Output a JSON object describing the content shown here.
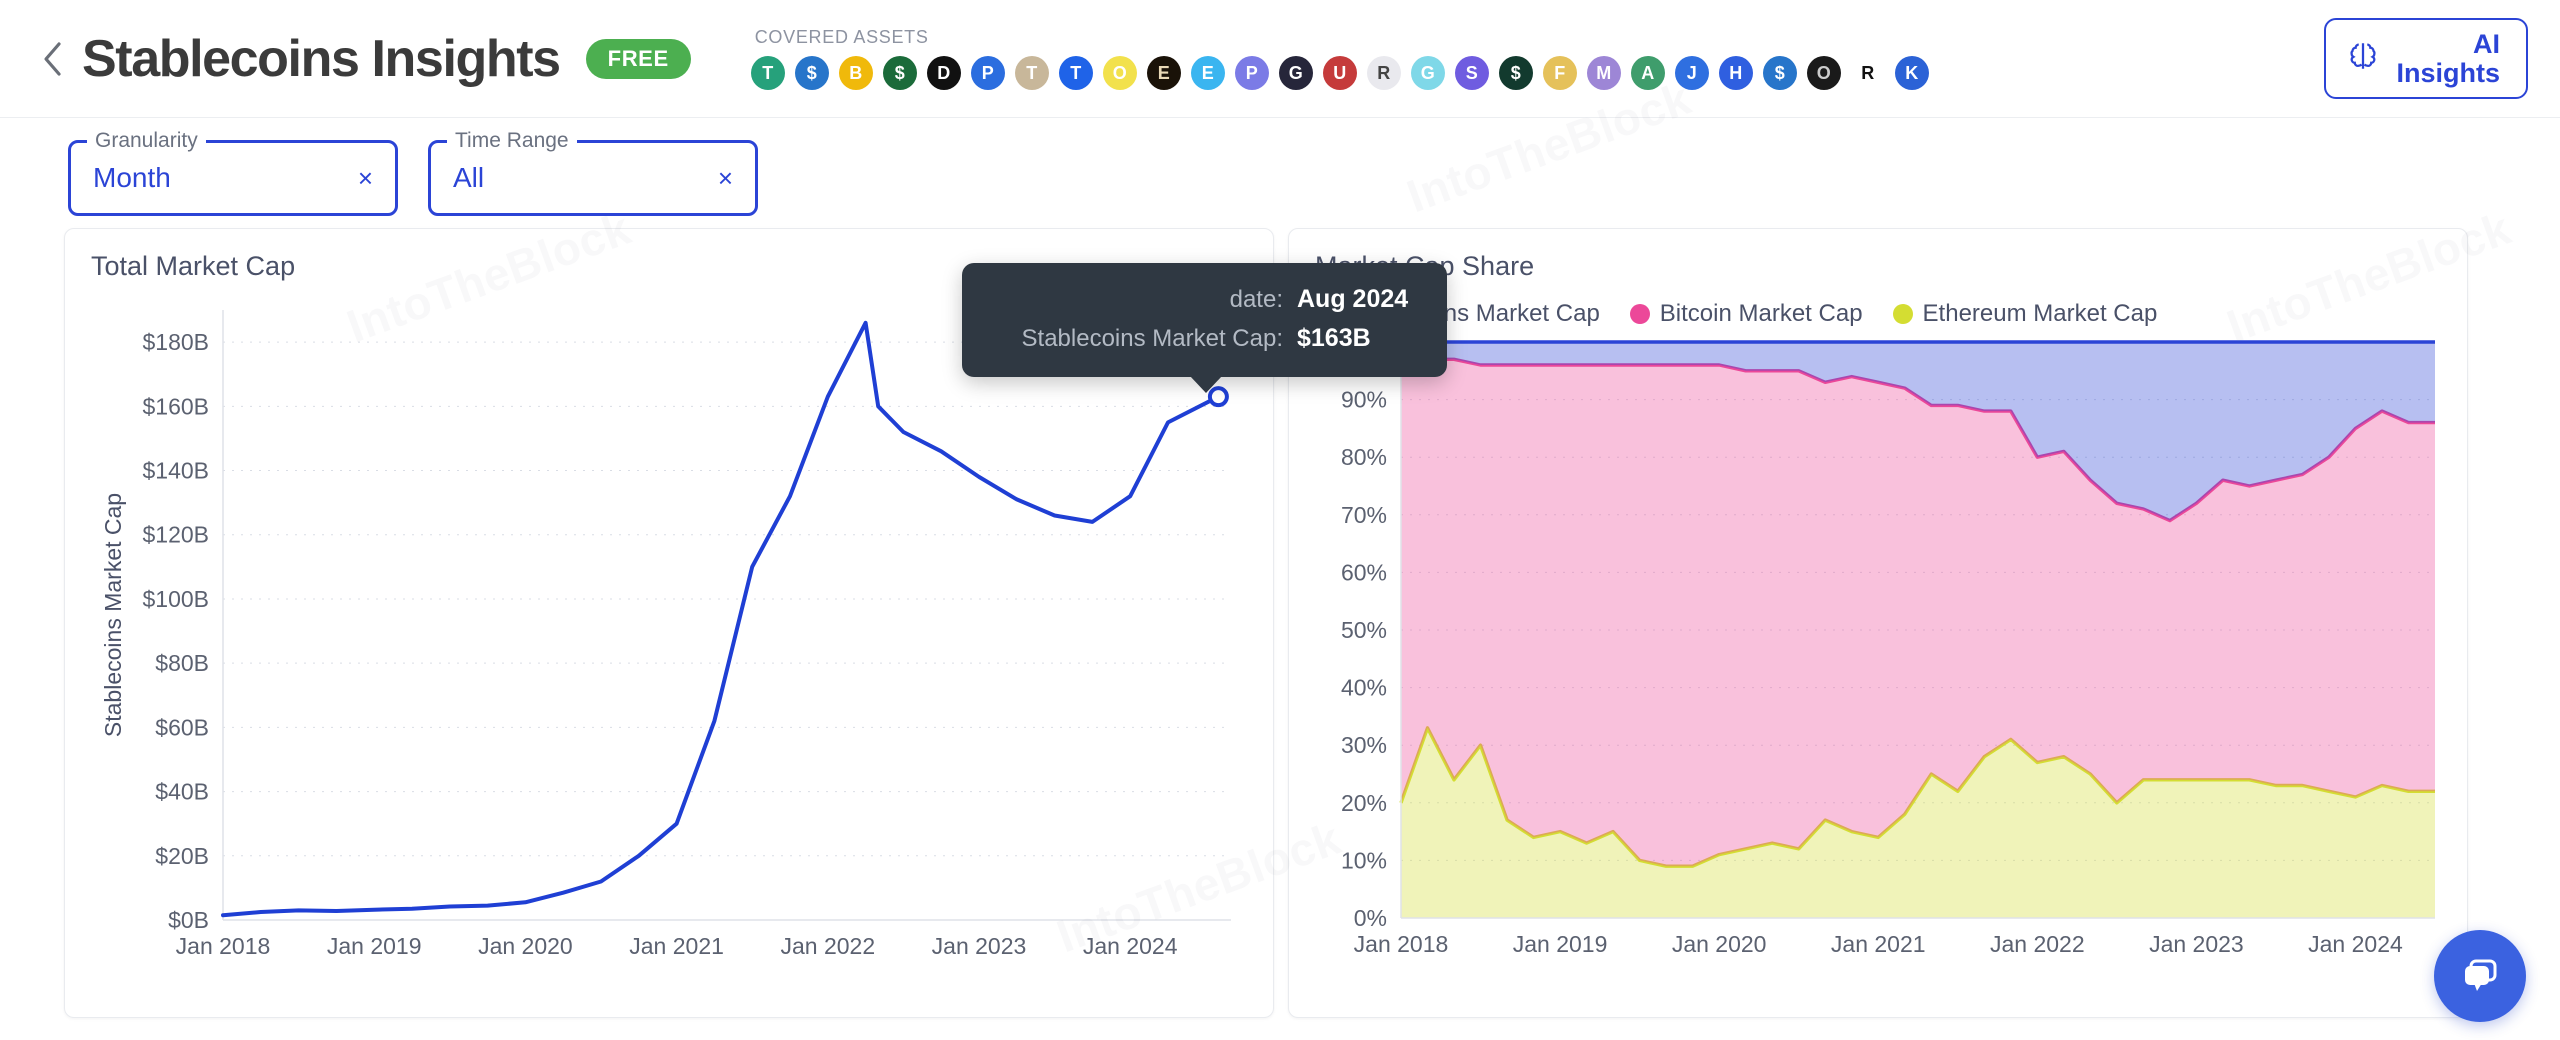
{
  "header": {
    "back_icon": "chevron-left-icon",
    "title": "Stablecoins Insights",
    "badge": "FREE",
    "covered_assets_label": "COVERED ASSETS",
    "ai_button": {
      "line1": "AI",
      "line2": "Insights",
      "icon": "brain-icon"
    },
    "assets": [
      {
        "name": "tether",
        "symbol": "T",
        "bg": "#26a17b",
        "fg": "#ffffff"
      },
      {
        "name": "usd-coin",
        "symbol": "$",
        "bg": "#2775ca",
        "fg": "#ffffff"
      },
      {
        "name": "binance-usd",
        "symbol": "B",
        "bg": "#f0b90b",
        "fg": "#ffffff"
      },
      {
        "name": "trueusd",
        "symbol": "$",
        "bg": "#1b6b3a",
        "fg": "#ffffff"
      },
      {
        "name": "dai",
        "symbol": "D",
        "bg": "#111111",
        "fg": "#ffffff"
      },
      {
        "name": "paypal-usd",
        "symbol": "P",
        "bg": "#2b6ddf",
        "fg": "#ffffff"
      },
      {
        "name": "tether-gold",
        "symbol": "T",
        "bg": "#c8b79a",
        "fg": "#ffffff"
      },
      {
        "name": "tusd",
        "symbol": "T",
        "bg": "#1f63e8",
        "fg": "#ffffff"
      },
      {
        "name": "ethena-usde",
        "symbol": "O",
        "bg": "#f2e14c",
        "fg": "#ffffff"
      },
      {
        "name": "eos-usd",
        "symbol": "E",
        "bg": "#1a1208",
        "fg": "#e9d9b6"
      },
      {
        "name": "euro-coin",
        "symbol": "E",
        "bg": "#3ab5f0",
        "fg": "#ffffff"
      },
      {
        "name": "pax-dollar",
        "symbol": "P",
        "bg": "#7b7be6",
        "fg": "#ffffff"
      },
      {
        "name": "gemini-dollar",
        "symbol": "G",
        "bg": "#26263a",
        "fg": "#ffffff"
      },
      {
        "name": "usdd-flag",
        "symbol": "U",
        "bg": "#c53b3b",
        "fg": "#ffffff"
      },
      {
        "name": "rainbow-coin",
        "symbol": "R",
        "bg": "#e9e9ee",
        "fg": "#444444"
      },
      {
        "name": "gho",
        "symbol": "G",
        "bg": "#7fd8e8",
        "fg": "#ffffff"
      },
      {
        "name": "susd",
        "symbol": "S",
        "bg": "#6f5ce0",
        "fg": "#ffffff"
      },
      {
        "name": "frax",
        "symbol": "$",
        "bg": "#123a2e",
        "fg": "#ffffff"
      },
      {
        "name": "flex-usd",
        "symbol": "F",
        "bg": "#e5c15a",
        "fg": "#ffffff"
      },
      {
        "name": "mim",
        "symbol": "M",
        "bg": "#9d86d6",
        "fg": "#ffffff"
      },
      {
        "name": "alchemix-usd",
        "symbol": "A",
        "bg": "#3f9d6c",
        "fg": "#ffffff"
      },
      {
        "name": "usdj",
        "symbol": "J",
        "bg": "#2f6fe0",
        "fg": "#ffffff"
      },
      {
        "name": "husd",
        "symbol": "H",
        "bg": "#2f5fe0",
        "fg": "#ffffff"
      },
      {
        "name": "usdp",
        "symbol": "$",
        "bg": "#2775ca",
        "fg": "#ffffff"
      },
      {
        "name": "ousd",
        "symbol": "O",
        "bg": "#1a1a1a",
        "fg": "#cccccc"
      },
      {
        "name": "reserve",
        "symbol": "R",
        "bg": "#ffffff",
        "fg": "#111111"
      },
      {
        "name": "kava-usd",
        "symbol": "K",
        "bg": "#2b62d6",
        "fg": "#ffffff"
      }
    ]
  },
  "filters": [
    {
      "name": "granularity",
      "legend": "Granularity",
      "value": "Month",
      "clear": "×"
    },
    {
      "name": "time-range",
      "legend": "Time Range",
      "value": "All",
      "clear": "×"
    }
  ],
  "tooltip": {
    "rows": [
      {
        "key": "date:",
        "value": "Aug 2024"
      },
      {
        "key": "Stablecoins Market Cap:",
        "value": "$163B"
      }
    ]
  },
  "chat": {
    "icon": "chat-bubble-icon"
  },
  "colors": {
    "accent_blue": "#2b44d6",
    "line_blue": "#1f3fd4",
    "bitcoin_pink": "#ec4899",
    "ethereum_yellow": "#d4dd32",
    "stablecoin_blue": "#2b44d6",
    "badge_green": "#4caf50",
    "tooltip_bg": "#2f3842"
  },
  "chart_data": [
    {
      "id": "total-market-cap",
      "type": "line",
      "title": "Total Market Cap",
      "xlabel": "",
      "ylabel": "Stablecoins Market Cap",
      "ylim": [
        0,
        190
      ],
      "yticks": [
        "$0B",
        "$20B",
        "$40B",
        "$60B",
        "$80B",
        "$100B",
        "$120B",
        "$140B",
        "$160B",
        "$180B"
      ],
      "ytick_values": [
        0,
        20,
        40,
        60,
        80,
        100,
        120,
        140,
        160,
        180
      ],
      "xticks": [
        "Jan 2018",
        "Jan 2019",
        "Jan 2020",
        "Jan 2021",
        "Jan 2022",
        "Jan 2023",
        "Jan 2024"
      ],
      "grid": true,
      "legend_position": "none",
      "series": [
        {
          "name": "Stablecoins Market Cap",
          "color": "#1f3fd4",
          "x": [
            "Jan 2018",
            "Apr 2018",
            "Jul 2018",
            "Oct 2018",
            "Jan 2019",
            "Apr 2019",
            "Jul 2019",
            "Oct 2019",
            "Jan 2020",
            "Apr 2020",
            "Jul 2020",
            "Oct 2020",
            "Jan 2021",
            "Apr 2021",
            "Jul 2021",
            "Oct 2021",
            "Jan 2022",
            "Apr 2022",
            "May 2022",
            "Jul 2022",
            "Oct 2022",
            "Jan 2023",
            "Apr 2023",
            "Jul 2023",
            "Oct 2023",
            "Jan 2024",
            "Apr 2024",
            "Aug 2024"
          ],
          "values": [
            1.5,
            2.5,
            3.0,
            2.8,
            3.2,
            3.5,
            4.2,
            4.5,
            5.5,
            8.5,
            12.0,
            20.0,
            30.0,
            62.0,
            110.0,
            132.0,
            163.0,
            186.0,
            160.0,
            152.0,
            146.0,
            138.0,
            131.0,
            126.0,
            124.0,
            132.0,
            155.0,
            163.0
          ]
        }
      ],
      "highlight_point": {
        "x": "Aug 2024",
        "y": 163,
        "label": "$163B"
      }
    },
    {
      "id": "market-cap-share",
      "type": "area",
      "title": "Market Cap Share",
      "title_visible_fragment": "t Cap Share",
      "xlabel": "",
      "ylabel": "",
      "ylim": [
        0,
        100
      ],
      "yticks": [
        "0%",
        "10%",
        "20%",
        "30%",
        "40%",
        "50%",
        "60%",
        "70%",
        "80%",
        "90%"
      ],
      "ytick_values": [
        0,
        10,
        20,
        30,
        40,
        50,
        60,
        70,
        80,
        90
      ],
      "xticks": [
        "Jan 2018",
        "Jan 2019",
        "Jan 2020",
        "Jan 2021",
        "Jan 2022",
        "Jan 2023",
        "Jan 2024"
      ],
      "grid": true,
      "stacked": true,
      "legend_position": "top",
      "legend": [
        {
          "name": "Stablecoins Market Cap",
          "color": "#2b44d6"
        },
        {
          "name": "Bitcoin Market Cap",
          "color": "#ec4899"
        },
        {
          "name": "Ethereum Market Cap",
          "color": "#d4dd32"
        }
      ],
      "x": [
        "Jan 2018",
        "Mar 2018",
        "May 2018",
        "Jul 2018",
        "Sep 2018",
        "Nov 2018",
        "Jan 2019",
        "Mar 2019",
        "May 2019",
        "Jul 2019",
        "Sep 2019",
        "Nov 2019",
        "Jan 2020",
        "Mar 2020",
        "May 2020",
        "Jul 2020",
        "Sep 2020",
        "Nov 2020",
        "Jan 2021",
        "Mar 2021",
        "May 2021",
        "Jul 2021",
        "Sep 2021",
        "Nov 2021",
        "Jan 2022",
        "Mar 2022",
        "May 2022",
        "Jul 2022",
        "Sep 2022",
        "Nov 2022",
        "Jan 2023",
        "Mar 2023",
        "May 2023",
        "Jul 2023",
        "Sep 2023",
        "Nov 2023",
        "Jan 2024",
        "Mar 2024",
        "May 2024",
        "Aug 2024"
      ],
      "series": [
        {
          "name": "Ethereum Market Cap",
          "color": "#d4dd32",
          "values": [
            20,
            33,
            24,
            30,
            17,
            14,
            15,
            13,
            15,
            10,
            9,
            9,
            11,
            12,
            13,
            12,
            17,
            15,
            14,
            18,
            25,
            22,
            28,
            31,
            27,
            28,
            25,
            20,
            24,
            24,
            24,
            24,
            24,
            23,
            23,
            22,
            21,
            23,
            22,
            22
          ]
        },
        {
          "name": "Bitcoin Market Cap",
          "color": "#ec4899",
          "values": [
            78,
            64,
            73,
            66,
            79,
            82,
            81,
            83,
            81,
            86,
            87,
            87,
            85,
            83,
            82,
            83,
            76,
            79,
            79,
            74,
            64,
            67,
            60,
            57,
            53,
            53,
            51,
            52,
            47,
            45,
            48,
            52,
            51,
            53,
            54,
            58,
            64,
            65,
            64,
            64
          ]
        },
        {
          "name": "Stablecoins Market Cap",
          "color": "#2b44d6",
          "values": [
            2,
            3,
            3,
            4,
            4,
            4,
            4,
            4,
            4,
            4,
            4,
            4,
            4,
            5,
            5,
            5,
            7,
            6,
            7,
            8,
            11,
            11,
            12,
            12,
            20,
            19,
            24,
            28,
            29,
            31,
            28,
            24,
            25,
            24,
            23,
            20,
            15,
            12,
            14,
            14
          ]
        }
      ]
    }
  ]
}
